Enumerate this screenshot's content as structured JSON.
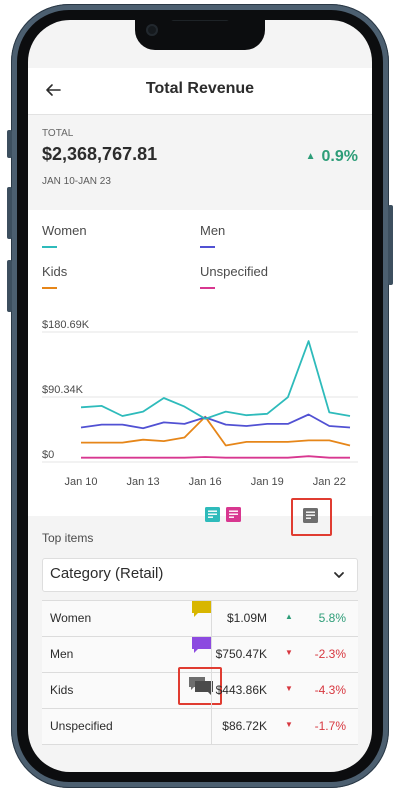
{
  "header": {
    "title": "Total Revenue"
  },
  "summary": {
    "total_label": "TOTAL",
    "total_value": "$2,368,767.81",
    "date_range": "JAN 10-JAN 23",
    "change": "0.9%",
    "change_direction": "up"
  },
  "legend": [
    {
      "label": "Women",
      "color": "#2ebbbb"
    },
    {
      "label": "Men",
      "color": "#5151d3"
    },
    {
      "label": "Kids",
      "color": "#e68619"
    },
    {
      "label": "Unspecified",
      "color": "#d83790"
    }
  ],
  "chart_data": {
    "type": "line",
    "x": [
      "Jan 10",
      "Jan 11",
      "Jan 12",
      "Jan 13",
      "Jan 14",
      "Jan 15",
      "Jan 16",
      "Jan 17",
      "Jan 18",
      "Jan 19",
      "Jan 20",
      "Jan 21",
      "Jan 22",
      "Jan 23"
    ],
    "x_tick_labels": [
      "Jan 10",
      "Jan 13",
      "Jan 16",
      "Jan 19",
      "Jan 22"
    ],
    "y_tick_labels": [
      "$180.69K",
      "$90.34K",
      "$0"
    ],
    "ylim": [
      0,
      180690
    ],
    "grid": "horizontal",
    "series": [
      {
        "name": "Women",
        "color": "#2ebbbb",
        "values": [
          76000,
          78000,
          64000,
          70000,
          89000,
          77000,
          60000,
          70000,
          65000,
          67000,
          90000,
          168000,
          69000,
          64000
        ]
      },
      {
        "name": "Men",
        "color": "#5151d3",
        "values": [
          48000,
          52000,
          52000,
          47000,
          55000,
          53000,
          62000,
          52000,
          50000,
          53000,
          53000,
          66000,
          50000,
          48000
        ]
      },
      {
        "name": "Kids",
        "color": "#e68619",
        "values": [
          27000,
          27000,
          27000,
          31000,
          29000,
          34000,
          63000,
          23000,
          28000,
          28000,
          28000,
          30000,
          30000,
          23000
        ]
      },
      {
        "name": "Unspecified",
        "color": "#d83790",
        "values": [
          6000,
          6000,
          6000,
          6000,
          6000,
          6000,
          7000,
          6000,
          6000,
          6000,
          6000,
          8000,
          6000,
          6000
        ]
      }
    ]
  },
  "chart_icons": [
    {
      "name": "teal-annotation-icon",
      "color": "#2ebbbb"
    },
    {
      "name": "pink-annotation-icon",
      "color": "#d83790"
    },
    {
      "name": "annotation-list-icon",
      "color": "#6e6e6e"
    }
  ],
  "top_items": {
    "label": "Top items",
    "dropdown_value": "Category (Retail)",
    "rows": [
      {
        "name": "Women",
        "value": "$1.09M",
        "direction": "up",
        "change": "5.8%",
        "flag_color": "#d8b600"
      },
      {
        "name": "Men",
        "value": "$750.47K",
        "direction": "down",
        "change": "-2.3%",
        "flag_color": "#8c4ae0"
      },
      {
        "name": "Kids",
        "value": "$443.86K",
        "direction": "down",
        "change": "-4.3%",
        "flag_color": "#6e6e6e"
      },
      {
        "name": "Unspecified",
        "value": "$86.72K",
        "direction": "down",
        "change": "-1.7%",
        "flag_color": ""
      }
    ]
  }
}
